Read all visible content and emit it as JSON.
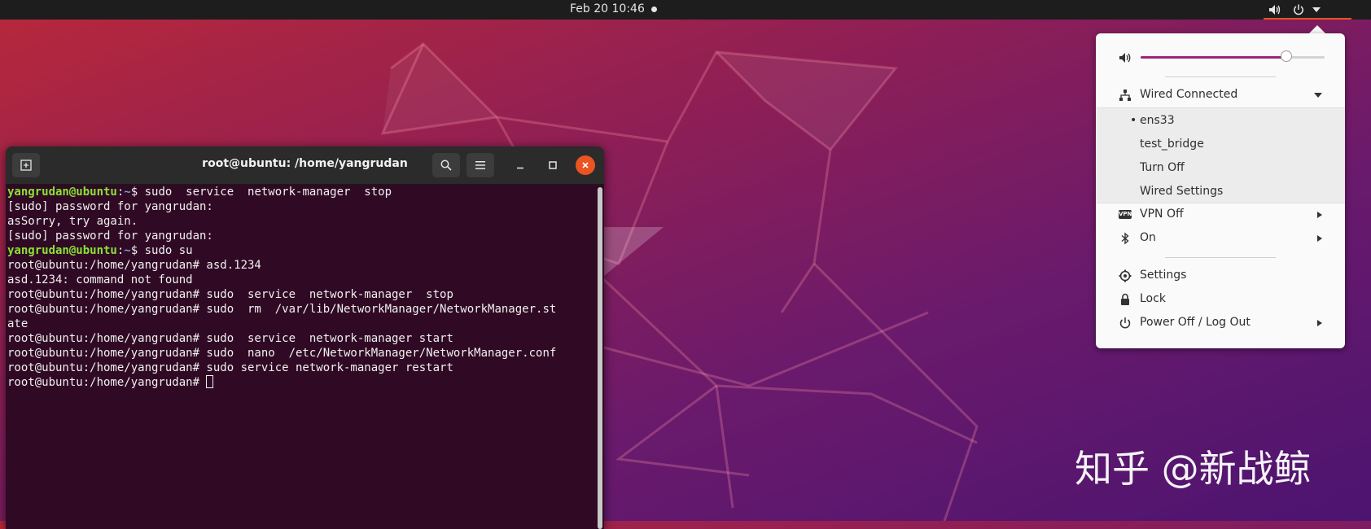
{
  "topbar": {
    "clock": "Feb 20  10:46",
    "icons": [
      "volume-icon",
      "power-icon",
      "chevron-down-icon"
    ]
  },
  "terminal": {
    "title": "root@ubuntu: /home/yangrudan",
    "lines": [
      [
        {
          "t": "yangrudan@ubuntu",
          "c": "green"
        },
        {
          "t": ":",
          "c": ""
        },
        {
          "t": "~",
          "c": "blue"
        },
        {
          "t": "$ sudo  service  network-manager  stop",
          "c": ""
        }
      ],
      [
        {
          "t": "[sudo] password for yangrudan:",
          "c": ""
        }
      ],
      [
        {
          "t": "asSorry, try again.",
          "c": ""
        }
      ],
      [
        {
          "t": "[sudo] password for yangrudan:",
          "c": ""
        }
      ],
      [
        {
          "t": "yangrudan@ubuntu",
          "c": "green"
        },
        {
          "t": ":",
          "c": ""
        },
        {
          "t": "~",
          "c": "blue"
        },
        {
          "t": "$ sudo su",
          "c": ""
        }
      ],
      [
        {
          "t": "root@ubuntu:/home/yangrudan# asd.1234",
          "c": ""
        }
      ],
      [
        {
          "t": "asd.1234: command not found",
          "c": ""
        }
      ],
      [
        {
          "t": "root@ubuntu:/home/yangrudan# sudo  service  network-manager  stop",
          "c": ""
        }
      ],
      [
        {
          "t": "root@ubuntu:/home/yangrudan# sudo  rm  /var/lib/NetworkManager/NetworkManager.st",
          "c": ""
        }
      ],
      [
        {
          "t": "ate",
          "c": ""
        }
      ],
      [
        {
          "t": "root@ubuntu:/home/yangrudan# sudo  service  network-manager start",
          "c": ""
        }
      ],
      [
        {
          "t": "root@ubuntu:/home/yangrudan# sudo  nano  /etc/NetworkManager/NetworkManager.conf",
          "c": ""
        }
      ],
      [
        {
          "t": "root@ubuntu:/home/yangrudan# sudo service network-manager restart",
          "c": ""
        }
      ],
      [
        {
          "t": "root@ubuntu:/home/yangrudan# ",
          "c": ""
        },
        {
          "t": "",
          "c": "cursor"
        }
      ]
    ]
  },
  "system_menu": {
    "volume_level": 0.79,
    "wired": "Wired Connected",
    "wired_items": [
      "ens33",
      "test_bridge",
      "Turn Off",
      "Wired Settings"
    ],
    "wired_active_bullet": "•",
    "vpn": "VPN Off",
    "vpn_icon_text": "VPN",
    "bluetooth": "On",
    "settings": "Settings",
    "lock": "Lock",
    "power": "Power Off / Log Out"
  },
  "watermark": "知乎 @新战鲸",
  "colors": {
    "accent": "#e95420",
    "terminal_bg": "#300a24",
    "prompt_user": "#8ae234",
    "prompt_path": "#729fcf",
    "slider_fill": "#9e2576"
  }
}
